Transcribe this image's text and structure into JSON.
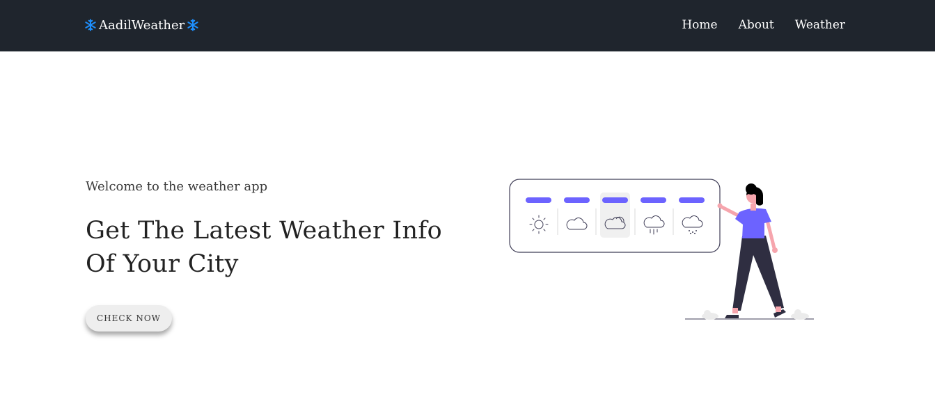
{
  "navbar": {
    "brand": "AadilWeather",
    "brand_icon": "snowflake-icon",
    "links": [
      {
        "label": "Home"
      },
      {
        "label": "About"
      },
      {
        "label": "Weather"
      }
    ]
  },
  "hero": {
    "welcome": "Welcome to the weather app",
    "headline_line1": "Get The Latest Weather Info",
    "headline_line2": "Of Your City",
    "cta_label": "CHECK NOW"
  },
  "illustration": {
    "icons": [
      "sun-icon",
      "cloud-icon",
      "cloudy-icon",
      "rain-icon",
      "snow-icon"
    ],
    "selected": 2
  },
  "colors": {
    "navbar_bg": "#1f252d",
    "accent": "#6c63ff",
    "snowflake": "#1e90ff"
  }
}
